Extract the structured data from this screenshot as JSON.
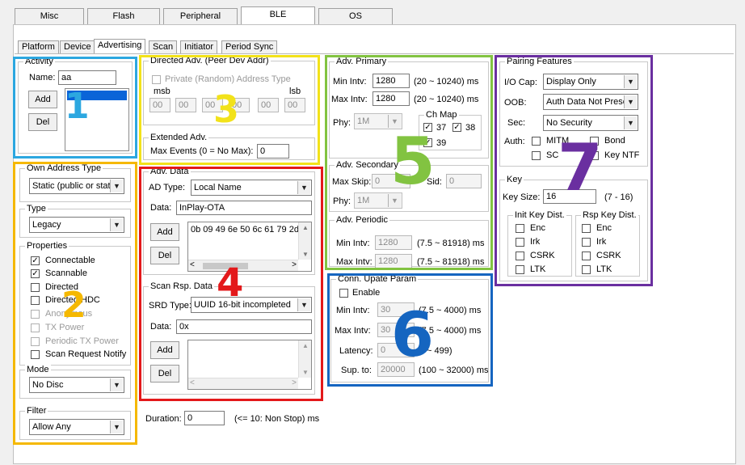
{
  "top_tabs": [
    "Misc",
    "Flash",
    "Peripheral",
    "BLE",
    "OS"
  ],
  "sub_tabs": [
    "Platform",
    "Device",
    "Advertising",
    "Scan",
    "Initiator",
    "Period Sync"
  ],
  "activity": {
    "title": "Activity",
    "name_label": "Name:",
    "name_value": "aa",
    "add": "Add",
    "del": "Del"
  },
  "own_addr": {
    "title": "Own Address Type",
    "value": "Static (public or stat"
  },
  "type": {
    "title": "Type",
    "value": "Legacy"
  },
  "properties": {
    "title": "Properties",
    "items": [
      "Connectable",
      "Scannable",
      "Directed",
      "Directed HDC",
      "Anonymous",
      "TX Power",
      "Periodic TX Power",
      "Scan Request Notify"
    ]
  },
  "mode": {
    "title": "Mode",
    "value": "No Disc"
  },
  "filter": {
    "title": "Filter",
    "value": "Allow Any"
  },
  "directed": {
    "title": "Directed Adv. (Peer Dev Addr)",
    "private": "Private (Random) Address Type",
    "msb": "msb",
    "lsb": "lsb",
    "bytes": [
      "00",
      "00",
      "00",
      "00",
      "00",
      "00"
    ]
  },
  "extended": {
    "title": "Extended Adv.",
    "max_events_label": "Max Events (0 = No Max):",
    "max_events": "0"
  },
  "adv_data": {
    "title": "Adv. Data",
    "ad_type_label": "AD Type:",
    "ad_type": "Local Name",
    "data_label": "Data:",
    "data": "InPlay-OTA",
    "hex": "0b 09 49 6e 50 6c 61 79 2d",
    "add": "Add",
    "del": "Del"
  },
  "scan_rsp": {
    "title": "Scan Rsp. Data",
    "srd_label": "SRD Type:",
    "srd": "UUID 16-bit incompleted",
    "data_label": "Data:",
    "data": "0x",
    "add": "Add",
    "del": "Del"
  },
  "duration": {
    "label": "Duration:",
    "value": "0",
    "hint": "(<= 10: Non Stop) ms"
  },
  "adv_primary": {
    "title": "Adv. Primary",
    "min_label": "Min Intv:",
    "min": "1280",
    "min_range": "(20 ~ 10240) ms",
    "max_label": "Max Intv:",
    "max": "1280",
    "max_range": "(20 ~ 10240) ms",
    "phy_label": "Phy:",
    "phy": "1M",
    "chmap_title": "Ch Map",
    "ch": [
      "37",
      "38",
      "39"
    ]
  },
  "adv_secondary": {
    "title": "Adv. Secondary",
    "skip_label": "Max Skip:",
    "skip": "0",
    "sid_label": "Sid:",
    "sid": "0",
    "phy_label": "Phy:",
    "phy": "1M"
  },
  "adv_periodic": {
    "title": "Adv. Periodic",
    "min_label": "Min Intv:",
    "min": "1280",
    "min_range": "(7.5 ~ 81918) ms",
    "max_label": "Max Intv:",
    "max": "1280",
    "max_range": "(7.5 ~ 81918) ms"
  },
  "conn": {
    "title": "Conn. Upate Param",
    "enable": "Enable",
    "min_label": "Min Intv:",
    "min": "30",
    "min_range": "(7.5 ~ 4000) ms",
    "max_label": "Max Intv:",
    "max": "30",
    "max_range": "(7.5 ~ 4000) ms",
    "lat_label": "Latency:",
    "lat": "0",
    "lat_range": "~ 499)",
    "sup_label": "Sup. to:",
    "sup": "20000",
    "sup_range": "(100 ~ 32000) ms"
  },
  "pairing": {
    "title": "Pairing Features",
    "io_label": "I/O Cap:",
    "io": "Display Only",
    "oob_label": "OOB:",
    "oob": "Auth Data Not Prese",
    "sec_label": "Sec:",
    "sec": "No Security",
    "auth_label": "Auth:",
    "mitm": "MITM",
    "bond": "Bond",
    "sc": "SC",
    "keyntf": "Key NTF"
  },
  "key": {
    "title": "Key",
    "size_label": "Key Size:",
    "size": "16",
    "size_range": "(7 - 16)",
    "init_title": "Init Key Dist.",
    "rsp_title": "Rsp Key Dist.",
    "items": [
      "Enc",
      "Irk",
      "CSRK",
      "LTK"
    ]
  },
  "numbers": [
    "1",
    "2",
    "3",
    "4",
    "5",
    "6",
    "7"
  ],
  "colors": {
    "c1": "#2ca7e0",
    "c2": "#f5b800",
    "c3": "#f2e21a",
    "c4": "#e3191b",
    "c5": "#82c341",
    "c6": "#1565c0",
    "c7": "#6a2fa0"
  }
}
